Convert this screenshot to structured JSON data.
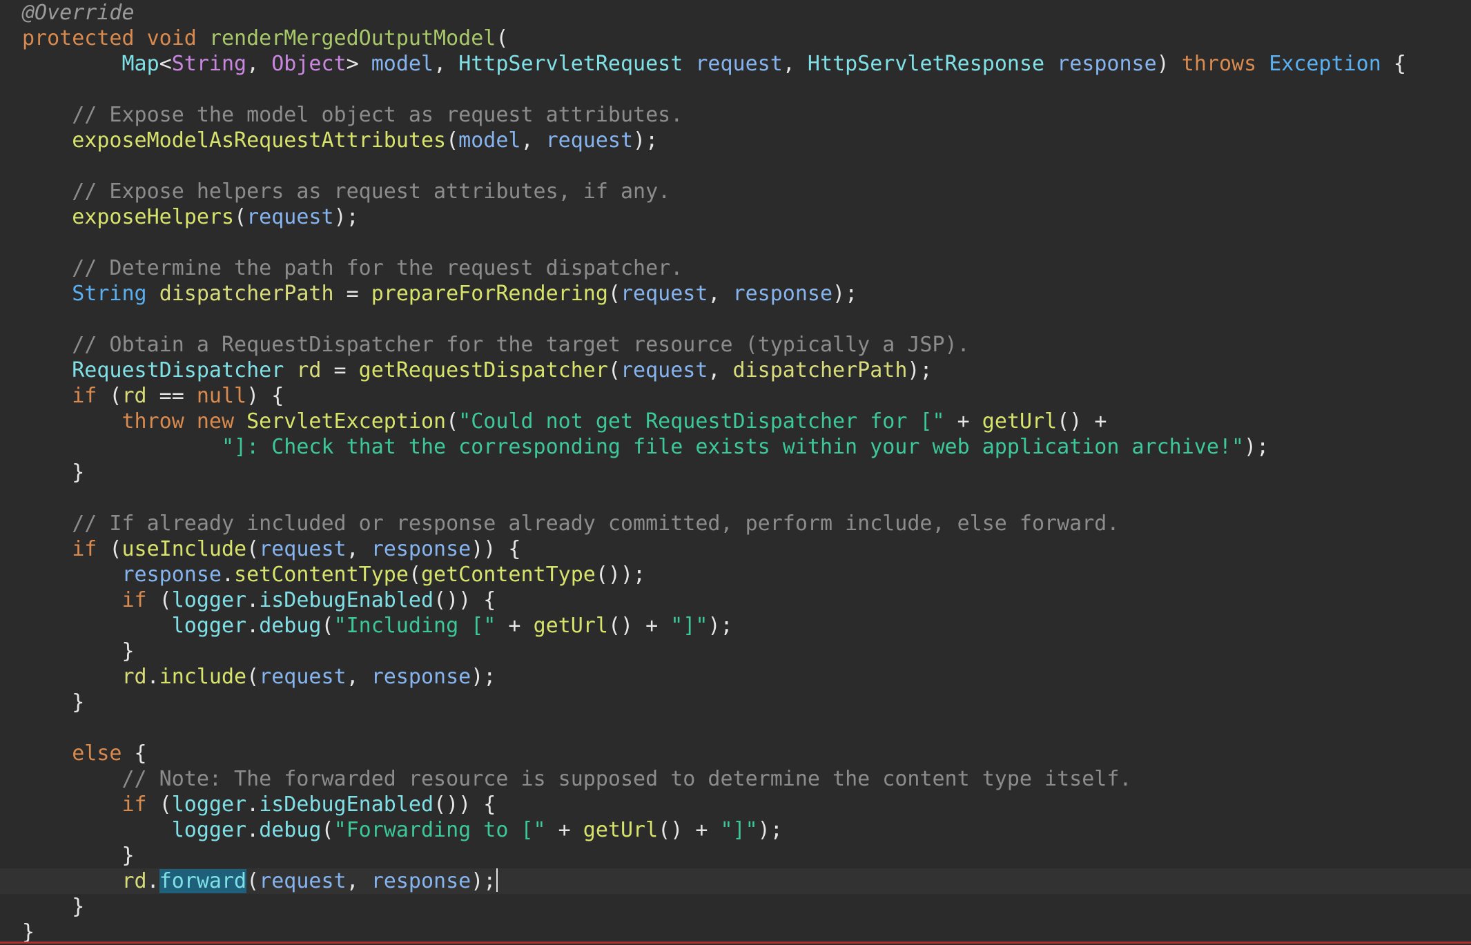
{
  "editor": {
    "current_line_index": 34,
    "lines": [
      [
        {
          "t": "@Override",
          "c": "ann"
        }
      ],
      [
        {
          "t": "protected",
          "c": "kw"
        },
        {
          "t": " ",
          "c": "plain"
        },
        {
          "t": "void",
          "c": "kw"
        },
        {
          "t": " ",
          "c": "plain"
        },
        {
          "t": "renderMergedOutputModel",
          "c": "fn"
        },
        {
          "t": "(",
          "c": "plain"
        }
      ],
      [
        {
          "t": "        ",
          "c": "plain"
        },
        {
          "t": "Map",
          "c": "type"
        },
        {
          "t": "<",
          "c": "plain"
        },
        {
          "t": "String",
          "c": "type3"
        },
        {
          "t": ", ",
          "c": "plain"
        },
        {
          "t": "Object",
          "c": "type3"
        },
        {
          "t": "> ",
          "c": "plain"
        },
        {
          "t": "model",
          "c": "var"
        },
        {
          "t": ", ",
          "c": "plain"
        },
        {
          "t": "HttpServletRequest",
          "c": "type"
        },
        {
          "t": " ",
          "c": "plain"
        },
        {
          "t": "request",
          "c": "var"
        },
        {
          "t": ", ",
          "c": "plain"
        },
        {
          "t": "HttpServletResponse",
          "c": "type"
        },
        {
          "t": " ",
          "c": "plain"
        },
        {
          "t": "response",
          "c": "var"
        },
        {
          "t": ") ",
          "c": "plain"
        },
        {
          "t": "throws",
          "c": "kw"
        },
        {
          "t": " ",
          "c": "plain"
        },
        {
          "t": "Exception",
          "c": "type2"
        },
        {
          "t": " {",
          "c": "plain"
        }
      ],
      [],
      [
        {
          "t": "    ",
          "c": "plain"
        },
        {
          "t": "// Expose the model object as request attributes.",
          "c": "com"
        }
      ],
      [
        {
          "t": "    ",
          "c": "plain"
        },
        {
          "t": "exposeModelAsRequestAttributes",
          "c": "method"
        },
        {
          "t": "(",
          "c": "plain"
        },
        {
          "t": "model",
          "c": "var"
        },
        {
          "t": ", ",
          "c": "plain"
        },
        {
          "t": "request",
          "c": "var"
        },
        {
          "t": ");",
          "c": "plain"
        }
      ],
      [],
      [
        {
          "t": "    ",
          "c": "plain"
        },
        {
          "t": "// Expose helpers as request attributes, if any.",
          "c": "com"
        }
      ],
      [
        {
          "t": "    ",
          "c": "plain"
        },
        {
          "t": "exposeHelpers",
          "c": "method"
        },
        {
          "t": "(",
          "c": "plain"
        },
        {
          "t": "request",
          "c": "var"
        },
        {
          "t": ");",
          "c": "plain"
        }
      ],
      [],
      [
        {
          "t": "    ",
          "c": "plain"
        },
        {
          "t": "// Determine the path for the request dispatcher.",
          "c": "com"
        }
      ],
      [
        {
          "t": "    ",
          "c": "plain"
        },
        {
          "t": "String",
          "c": "type2"
        },
        {
          "t": " ",
          "c": "plain"
        },
        {
          "t": "dispatcherPath",
          "c": "field"
        },
        {
          "t": " = ",
          "c": "plain"
        },
        {
          "t": "prepareForRendering",
          "c": "method"
        },
        {
          "t": "(",
          "c": "plain"
        },
        {
          "t": "request",
          "c": "var"
        },
        {
          "t": ", ",
          "c": "plain"
        },
        {
          "t": "response",
          "c": "var"
        },
        {
          "t": ");",
          "c": "plain"
        }
      ],
      [],
      [
        {
          "t": "    ",
          "c": "plain"
        },
        {
          "t": "// Obtain a RequestDispatcher for the target resource (typically a JSP).",
          "c": "com"
        }
      ],
      [
        {
          "t": "    ",
          "c": "plain"
        },
        {
          "t": "RequestDispatcher",
          "c": "type"
        },
        {
          "t": " ",
          "c": "plain"
        },
        {
          "t": "rd",
          "c": "field"
        },
        {
          "t": " = ",
          "c": "plain"
        },
        {
          "t": "getRequestDispatcher",
          "c": "method"
        },
        {
          "t": "(",
          "c": "plain"
        },
        {
          "t": "request",
          "c": "var"
        },
        {
          "t": ", ",
          "c": "plain"
        },
        {
          "t": "dispatcherPath",
          "c": "field"
        },
        {
          "t": ");",
          "c": "plain"
        }
      ],
      [
        {
          "t": "    ",
          "c": "plain"
        },
        {
          "t": "if",
          "c": "kw"
        },
        {
          "t": " (",
          "c": "plain"
        },
        {
          "t": "rd",
          "c": "field"
        },
        {
          "t": " == ",
          "c": "plain"
        },
        {
          "t": "null",
          "c": "null"
        },
        {
          "t": ") {",
          "c": "plain"
        }
      ],
      [
        {
          "t": "        ",
          "c": "plain"
        },
        {
          "t": "throw",
          "c": "kw"
        },
        {
          "t": " ",
          "c": "plain"
        },
        {
          "t": "new",
          "c": "kw"
        },
        {
          "t": " ",
          "c": "plain"
        },
        {
          "t": "ServletException",
          "c": "method"
        },
        {
          "t": "(",
          "c": "plain"
        },
        {
          "t": "\"Could not get RequestDispatcher for [\"",
          "c": "str"
        },
        {
          "t": " + ",
          "c": "plain"
        },
        {
          "t": "getUrl",
          "c": "method"
        },
        {
          "t": "() +",
          "c": "plain"
        }
      ],
      [
        {
          "t": "                ",
          "c": "plain"
        },
        {
          "t": "\"]: Check that the corresponding file exists within your web application archive!\"",
          "c": "str"
        },
        {
          "t": ");",
          "c": "plain"
        }
      ],
      [
        {
          "t": "    }",
          "c": "plain"
        }
      ],
      [],
      [
        {
          "t": "    ",
          "c": "plain"
        },
        {
          "t": "// If already included or response already committed, perform include, else forward.",
          "c": "com"
        }
      ],
      [
        {
          "t": "    ",
          "c": "plain"
        },
        {
          "t": "if",
          "c": "kw"
        },
        {
          "t": " (",
          "c": "plain"
        },
        {
          "t": "useInclude",
          "c": "method"
        },
        {
          "t": "(",
          "c": "plain"
        },
        {
          "t": "request",
          "c": "var"
        },
        {
          "t": ", ",
          "c": "plain"
        },
        {
          "t": "response",
          "c": "var"
        },
        {
          "t": ")) {",
          "c": "plain"
        }
      ],
      [
        {
          "t": "        ",
          "c": "plain"
        },
        {
          "t": "response",
          "c": "var"
        },
        {
          "t": ".",
          "c": "plain"
        },
        {
          "t": "setContentType",
          "c": "method"
        },
        {
          "t": "(",
          "c": "plain"
        },
        {
          "t": "getContentType",
          "c": "method"
        },
        {
          "t": "());",
          "c": "plain"
        }
      ],
      [
        {
          "t": "        ",
          "c": "plain"
        },
        {
          "t": "if",
          "c": "kw"
        },
        {
          "t": " (",
          "c": "plain"
        },
        {
          "t": "logger",
          "c": "type"
        },
        {
          "t": ".",
          "c": "plain"
        },
        {
          "t": "isDebugEnabled",
          "c": "type"
        },
        {
          "t": "()) {",
          "c": "plain"
        }
      ],
      [
        {
          "t": "            ",
          "c": "plain"
        },
        {
          "t": "logger",
          "c": "type"
        },
        {
          "t": ".",
          "c": "plain"
        },
        {
          "t": "debug",
          "c": "type"
        },
        {
          "t": "(",
          "c": "plain"
        },
        {
          "t": "\"Including [\"",
          "c": "str"
        },
        {
          "t": " + ",
          "c": "plain"
        },
        {
          "t": "getUrl",
          "c": "method"
        },
        {
          "t": "() + ",
          "c": "plain"
        },
        {
          "t": "\"]\"",
          "c": "str"
        },
        {
          "t": ");",
          "c": "plain"
        }
      ],
      [
        {
          "t": "        }",
          "c": "plain"
        }
      ],
      [
        {
          "t": "        ",
          "c": "plain"
        },
        {
          "t": "rd",
          "c": "field"
        },
        {
          "t": ".",
          "c": "plain"
        },
        {
          "t": "include",
          "c": "method"
        },
        {
          "t": "(",
          "c": "plain"
        },
        {
          "t": "request",
          "c": "var"
        },
        {
          "t": ", ",
          "c": "plain"
        },
        {
          "t": "response",
          "c": "var"
        },
        {
          "t": ");",
          "c": "plain"
        }
      ],
      [
        {
          "t": "    }",
          "c": "plain"
        }
      ],
      [],
      [
        {
          "t": "    ",
          "c": "plain"
        },
        {
          "t": "else",
          "c": "kw"
        },
        {
          "t": " {",
          "c": "plain"
        }
      ],
      [
        {
          "t": "        ",
          "c": "plain"
        },
        {
          "t": "// Note: The forwarded resource is supposed to determine the content type itself.",
          "c": "com"
        }
      ],
      [
        {
          "t": "        ",
          "c": "plain"
        },
        {
          "t": "if",
          "c": "kw"
        },
        {
          "t": " (",
          "c": "plain"
        },
        {
          "t": "logger",
          "c": "type"
        },
        {
          "t": ".",
          "c": "plain"
        },
        {
          "t": "isDebugEnabled",
          "c": "type"
        },
        {
          "t": "()) {",
          "c": "plain"
        }
      ],
      [
        {
          "t": "            ",
          "c": "plain"
        },
        {
          "t": "logger",
          "c": "type"
        },
        {
          "t": ".",
          "c": "plain"
        },
        {
          "t": "debug",
          "c": "type"
        },
        {
          "t": "(",
          "c": "plain"
        },
        {
          "t": "\"Forwarding to [\"",
          "c": "str"
        },
        {
          "t": " + ",
          "c": "plain"
        },
        {
          "t": "getUrl",
          "c": "method"
        },
        {
          "t": "() + ",
          "c": "plain"
        },
        {
          "t": "\"]\"",
          "c": "str"
        },
        {
          "t": ");",
          "c": "plain"
        }
      ],
      [
        {
          "t": "        }",
          "c": "plain"
        }
      ],
      [
        {
          "t": "        ",
          "c": "plain"
        },
        {
          "t": "rd",
          "c": "field"
        },
        {
          "t": ".",
          "c": "plain"
        },
        {
          "t": "forward",
          "c": "type",
          "sel": true
        },
        {
          "t": "(",
          "c": "plain"
        },
        {
          "t": "request",
          "c": "var"
        },
        {
          "t": ", ",
          "c": "plain"
        },
        {
          "t": "response",
          "c": "var"
        },
        {
          "t": ");",
          "c": "plain",
          "caret": true
        }
      ],
      [
        {
          "t": "    }",
          "c": "plain"
        }
      ],
      [
        {
          "t": "}",
          "c": "plain"
        }
      ]
    ]
  }
}
